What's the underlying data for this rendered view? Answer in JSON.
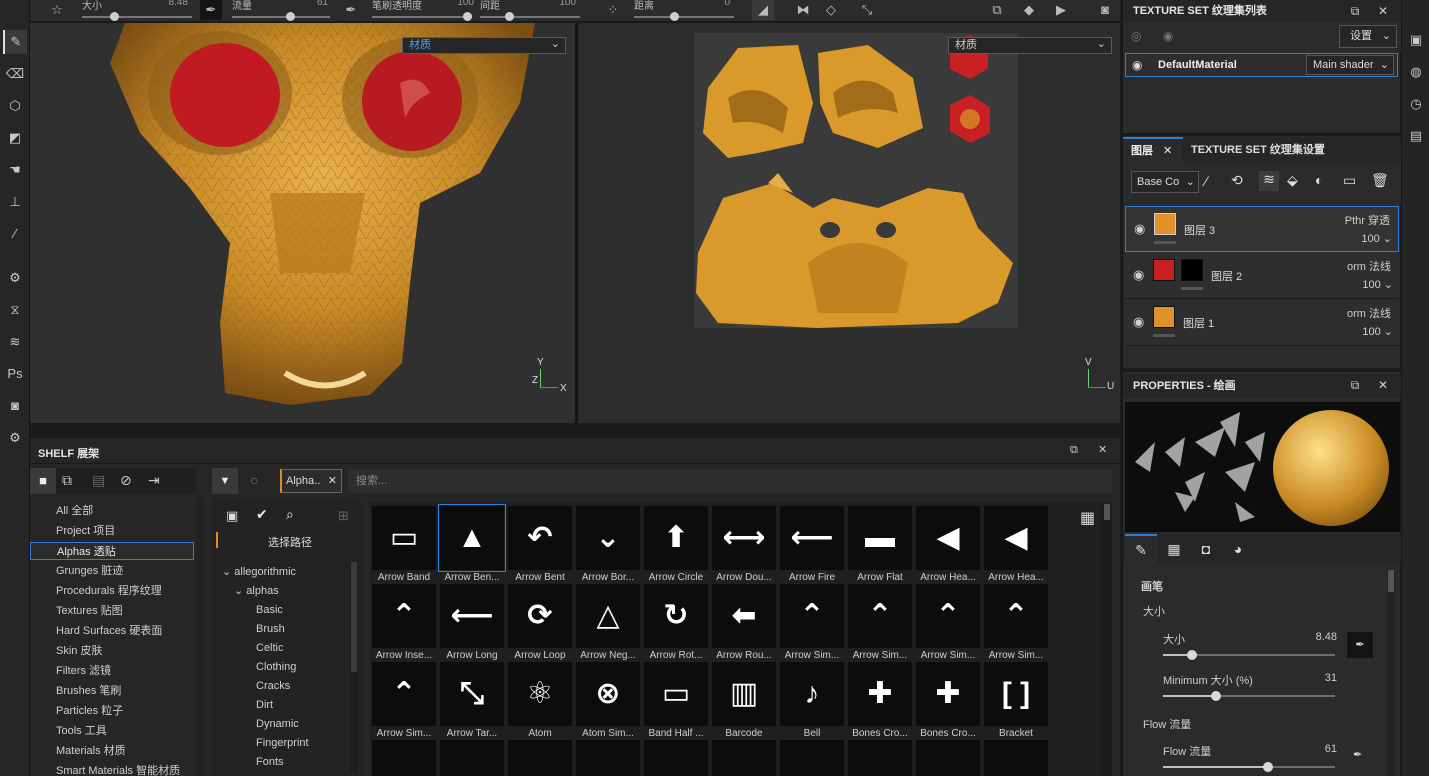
{
  "toolbar": {
    "size_label": "大小",
    "size_value": "8.48",
    "flow_label": "流量",
    "flow_value": "61",
    "stroke_opacity_label": "笔刷透明度",
    "stroke_opacity_value": "100",
    "spacing_label": "间距",
    "spacing_value": "100",
    "distance_label": "距离",
    "distance_value": "0"
  },
  "viewports": {
    "left_select": "材质",
    "right_select": "材质",
    "left_axis": {
      "y": "Y",
      "z": "Z",
      "x": "X"
    },
    "right_axis": {
      "v": "V",
      "u": "U"
    }
  },
  "texture_set_list": {
    "title": "TEXTURE SET 纹理集列表",
    "settings_label": "设置",
    "material_name": "DefaultMaterial",
    "shader": "Main shader"
  },
  "layers_panel": {
    "tab_layers": "图层",
    "tab_texture_settings": "TEXTURE SET 纹理集设置",
    "channel_select": "Base Co",
    "layers": [
      {
        "name": "图层 3",
        "blend": "Pthr 穿透",
        "opacity": "100",
        "thumb_color": "#e0922a"
      },
      {
        "name": "图层 2",
        "blend": "orm 法线",
        "opacity": "100",
        "thumb_color": "#c81f24"
      },
      {
        "name": "图层 1",
        "blend": "orm 法线",
        "opacity": "100",
        "thumb_color": "#e0922a"
      }
    ]
  },
  "properties": {
    "title": "PROPERTIES - 绘画",
    "section_brush": "画笔",
    "group_size": "大小",
    "size_label": "大小",
    "size_value": "8.48",
    "size_fraction": 0.17,
    "min_size_label": "Minimum 大小 (%)",
    "min_size_value": "31",
    "min_size_fraction": 0.31,
    "group_flow": "Flow 流量",
    "flow_label": "Flow 流量",
    "flow_value": "61",
    "flow_fraction": 0.61
  },
  "shelf": {
    "title": "SHELF 展架",
    "search_placeholder": "搜索...",
    "filter_chip": "Alpha..",
    "select_path": "选择路径",
    "categories": [
      "All 全部",
      "Project 项目",
      "Alphas 透贴",
      "Grunges 脏迹",
      "Procedurals 程序纹理",
      "Textures 贴图",
      "Hard Surfaces 硬表面",
      "Skin 皮肤",
      "Filters 滤镜",
      "Brushes 笔刷",
      "Particles 粒子",
      "Tools 工具",
      "Materials 材质",
      "Smart Materials 智能材质"
    ],
    "tree_root": "allegorithmic",
    "tree_child": "alphas",
    "tree_items": [
      "Basic",
      "Brush",
      "Celtic",
      "Clothing",
      "Cracks",
      "Dirt",
      "Dynamic",
      "Fingerprint",
      "Fonts"
    ],
    "tiles_row1": [
      "Arrow Band",
      "Arrow Ben...",
      "Arrow Bent",
      "Arrow Bor...",
      "Arrow Circle",
      "Arrow Dou...",
      "Arrow Fire",
      "Arrow Flat",
      "Arrow Hea...",
      "Arrow Hea..."
    ],
    "tiles_row2": [
      "Arrow Inse...",
      "Arrow Long",
      "Arrow Loop",
      "Arrow Neg...",
      "Arrow Rot...",
      "Arrow Rou...",
      "Arrow Sim...",
      "Arrow Sim...",
      "Arrow Sim...",
      "Arrow Sim..."
    ],
    "tiles_row3": [
      "Arrow Sim...",
      "Arrow Tar...",
      "Atom",
      "Atom Sim...",
      "Band Half ...",
      "Barcode",
      "Bell",
      "Bones Cro...",
      "Bones Cro...",
      "Bracket"
    ]
  },
  "colors": {
    "accent": "#2d7fd3",
    "gold": "#d99a2b",
    "red": "#c81f24"
  }
}
